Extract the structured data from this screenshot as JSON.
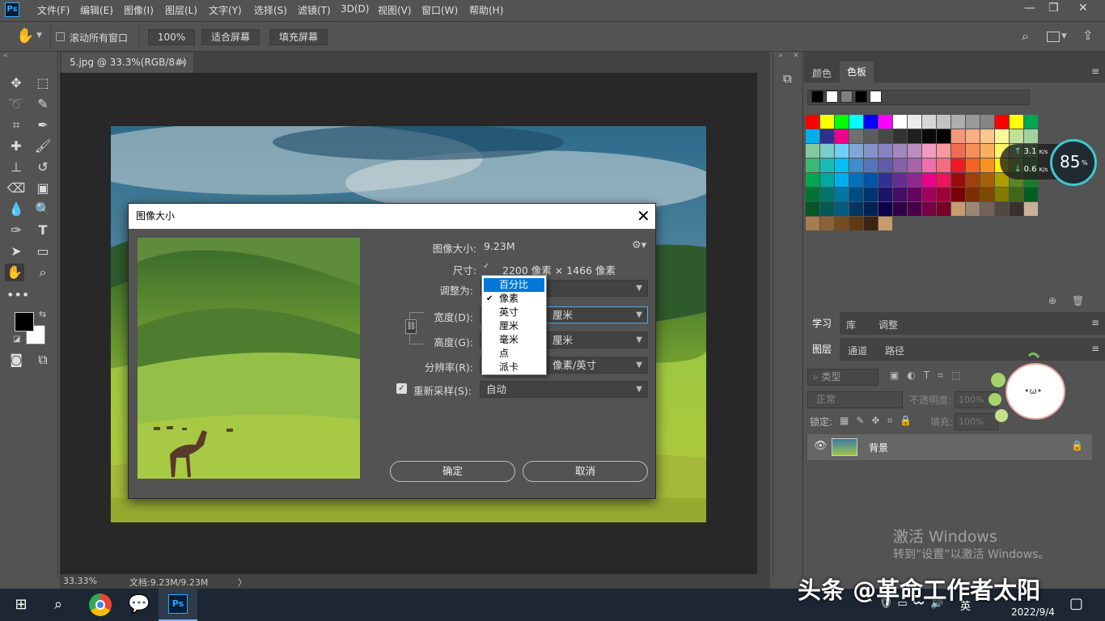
{
  "app": {
    "logo": "Ps"
  },
  "menu": [
    "文件(F)",
    "编辑(E)",
    "图像(I)",
    "图层(L)",
    "文字(Y)",
    "选择(S)",
    "滤镜(T)",
    "3D(D)",
    "视图(V)",
    "窗口(W)",
    "帮助(H)"
  ],
  "window_controls": {
    "minimize": "—",
    "restore": "❐",
    "close": "✕"
  },
  "options": {
    "scroll_all_label": "滚动所有窗口",
    "zoom_value": "100%",
    "fit_screen": "适合屏幕",
    "fill_screen": "填充屏幕"
  },
  "document": {
    "tab_title": "5.jpg @ 33.3%(RGB/8#)",
    "tab_close": "✕"
  },
  "status": {
    "zoom": "33.33%",
    "doc_size": "文档:9.23M/9.23M",
    "arrow": "〉"
  },
  "panels": {
    "top_tabs": [
      "颜色",
      "色板"
    ],
    "mid_tabs": [
      "学习",
      "库",
      "调整"
    ],
    "layer_tabs": [
      "图层",
      "通道",
      "路径"
    ],
    "filter_kind": "类型",
    "blend_mode": "正常",
    "opacity_label": "不透明度:",
    "opacity_value": "100%",
    "lock_label": "锁定:",
    "fill_label": "填充:",
    "fill_value": "100%",
    "layer_name": "背景"
  },
  "swatch_colors": {
    "recent": [
      "#000000",
      "#ffffff",
      "#808080",
      "#000000",
      "#ffffff"
    ],
    "rows": [
      [
        "#ff0000",
        "#ffff00",
        "#00ff00",
        "#00ffff",
        "#0000ff",
        "#ff00ff",
        "#ffffff",
        "#ebebeb",
        "#d6d6d6",
        "#c2c2c2",
        "#adadad",
        "#999999",
        "#858585",
        "#ff0000",
        "#ffff00",
        "#00a651"
      ],
      [
        "#00aeef",
        "#2e3192",
        "#ec008c",
        "#707070",
        "#5c5c5c",
        "#474747",
        "#333333",
        "#1f1f1f",
        "#0a0a0a",
        "#000000",
        "#f7977a",
        "#f9ad81",
        "#fdc68a",
        "#fff79a",
        "#c4df9b",
        "#a3d39c"
      ],
      [
        "#82ca9d",
        "#7bcdc8",
        "#6ecff6",
        "#7ea7d8",
        "#8493ca",
        "#8882be",
        "#a187be",
        "#bc8dbf",
        "#f49ac2",
        "#f6989d",
        "#f26c4f",
        "#f68e55",
        "#fbaf5c",
        "#fff467",
        "#acd372",
        "#7cc576"
      ],
      [
        "#3bb878",
        "#1abbb4",
        "#00bff3",
        "#438ccb",
        "#5574b9",
        "#605ca8",
        "#8560a8",
        "#a864a8",
        "#f06eaa",
        "#f26d7d",
        "#ed1c24",
        "#f26522",
        "#f7941d",
        "#fff200",
        "#8dc73f",
        "#39b54a"
      ],
      [
        "#00a651",
        "#00a99d",
        "#00aeef",
        "#0072bc",
        "#0054a6",
        "#2e3192",
        "#662d91",
        "#92278f",
        "#ec008c",
        "#ed145b",
        "#9e0b0f",
        "#a0410d",
        "#a36209",
        "#aba000",
        "#598527",
        "#1a7b30"
      ],
      [
        "#007236",
        "#00746b",
        "#0076a3",
        "#004b80",
        "#003471",
        "#1b1464",
        "#440e62",
        "#630460",
        "#9e005d",
        "#9e0039",
        "#790000",
        "#7b2e00",
        "#7d4900",
        "#827b00",
        "#406618",
        "#005e20"
      ],
      [
        "#005826",
        "#005952",
        "#005b7f",
        "#003663",
        "#002157",
        "#0d004c",
        "#32004b",
        "#4b0049",
        "#7b0046",
        "#7a0026",
        "#c69c6d",
        "#998675",
        "#736357",
        "#534741",
        "#37302d",
        "#c7b299"
      ],
      [
        "#a67c52",
        "#8c6239",
        "#754c24",
        "#603913",
        "#3c2415",
        "#c69c6d"
      ]
    ]
  },
  "dialog": {
    "title": "图像大小",
    "close": "✕",
    "image_size_label": "图像大小:",
    "image_size_value": "9.23M",
    "dimensions_label": "尺寸:",
    "dimensions_value": "2200 像素 × 1466 像素",
    "fit_label": "调整为:",
    "width_label": "宽度(D):",
    "width_unit": "厘米",
    "height_label": "高度(G):",
    "height_unit": "厘米",
    "resolution_label": "分辨率(R):",
    "resolution_unit": "像素/英寸",
    "resample_label": "重新采样(S):",
    "resample_value": "自动",
    "ok": "确定",
    "cancel": "取消",
    "unit_menu": [
      "百分比",
      "像素",
      "英寸",
      "厘米",
      "毫米",
      "点",
      "派卡"
    ],
    "unit_selected": "百分比",
    "unit_checked": "像素",
    "check_mark": "✔"
  },
  "net_widget": {
    "percent": "85",
    "percent_unit": "%",
    "up": "3.1",
    "down": "0.6",
    "unit": "K/s"
  },
  "windows_activation": {
    "line1": "激活 Windows",
    "line2": "转到“设置”以激活 Windows。"
  },
  "watermark_text": "头条 @革命工作者太阳",
  "taskbar": {
    "ime": "英",
    "date": "2022/9/4"
  }
}
